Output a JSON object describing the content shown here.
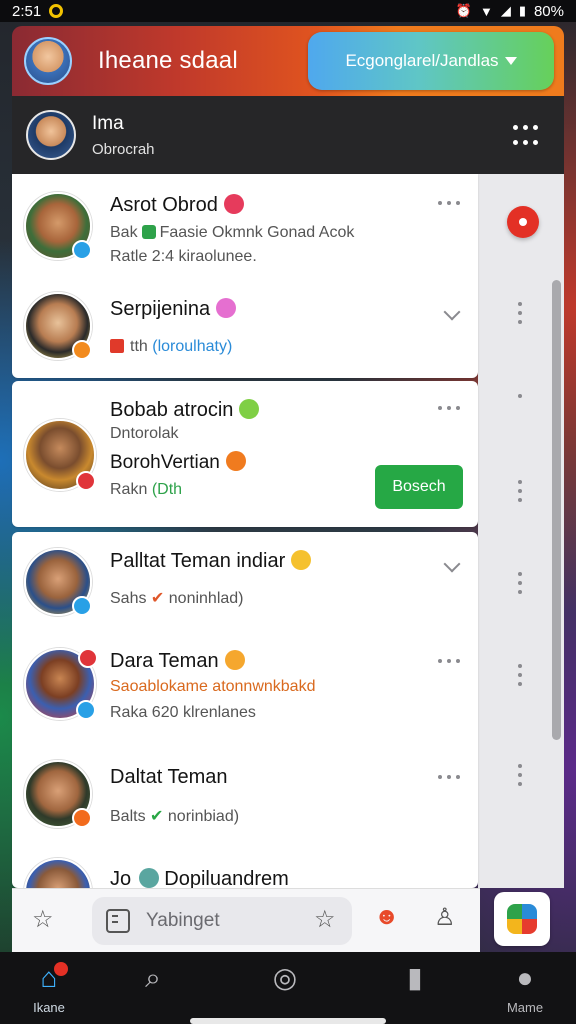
{
  "status_bar": {
    "time": "2:51",
    "battery": "80%"
  },
  "banner": {
    "title": "Iheane sdaal",
    "cta_label": "Ecgonglarel/Jandlas"
  },
  "profile": {
    "name": "Ima",
    "subtitle": "Obrocrah"
  },
  "chats": [
    {
      "name": "Asrot Obrod",
      "line1": "Bak",
      "line1_rest": "Faasie Okmnk Gonad Acok",
      "line2": "Ratle 2:4 kiraolunee.",
      "emoji_color": "#e63b5c",
      "badge_color": "#29a0e6"
    },
    {
      "name": "Serpijenina",
      "line1_prefix": "tth",
      "line1_link": "(loroulhaty)",
      "emoji_color": "#e56fd0",
      "badge_color": "#f28a1d"
    },
    {
      "name": "Bobab atrocin",
      "line1": "Dntorolak",
      "line2_name": "BorohVertian",
      "line3_prefix": "Rakn",
      "line3_accent": "(Dth",
      "action_label": "Bosech",
      "emoji_color": "#7fcf45",
      "emoji2_color": "#f07b1f",
      "badge_color": "#e0353a"
    },
    {
      "name": "Palltat Teman indiar",
      "line1_prefix": "Sahs",
      "line1_rest": "noninhlad)",
      "emoji_color": "#f5c12e",
      "badge_color": "#29a0e6"
    },
    {
      "name": "Dara Teman",
      "line1": "Saoablokame atonnwnkbakd",
      "line2": "Raka 620 klrenlanes",
      "emoji_color": "#f5a72e",
      "badge_color": "#29a0e6",
      "badge2_color": "#e0353a"
    },
    {
      "name": "Daltat Teman",
      "line1_prefix": "Balts",
      "line1_rest": "norinbiad)",
      "badge_color": "#f26b1d"
    },
    {
      "name": "Jo",
      "name_rest": "Dopiluandrem"
    }
  ],
  "composer": {
    "placeholder": "Yabinget"
  },
  "bottom_nav": {
    "home_label": "Ikane",
    "profile_label": "Mame"
  },
  "colors": {
    "accent_green": "#26a845",
    "accent_blue": "#2a8bd8",
    "notification_red": "#e33025",
    "nav_active": "#3fb3ff"
  }
}
